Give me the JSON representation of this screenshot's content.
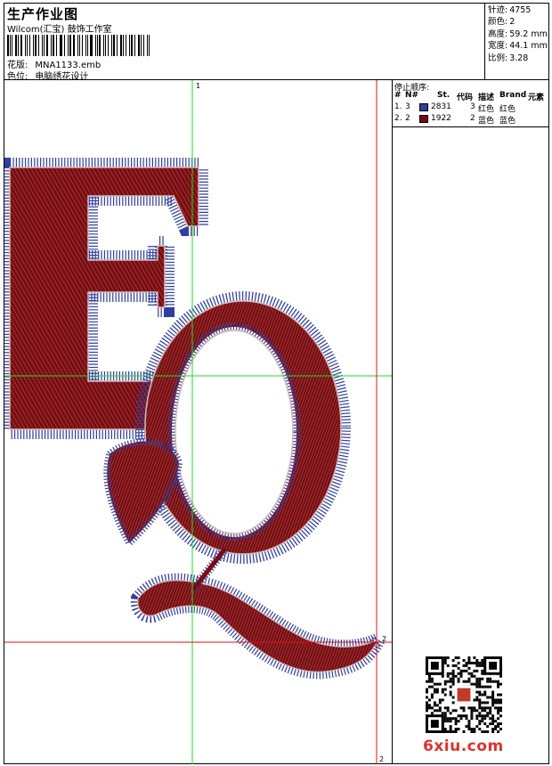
{
  "header": {
    "title": "生产作业图",
    "company": "Wilcom(汇宝) 鼓饰工作室",
    "design_label": "花版:",
    "design_value": "MNA1133.emb",
    "colorway_label": "色位:",
    "colorway_value": "电脑绣花设计"
  },
  "stats": {
    "stitches_label": "针迹:",
    "stitches_value": "4755",
    "colors_label": "颜色:",
    "colors_value": "2",
    "height_label": "高度:",
    "height_value": "59.2 mm",
    "width_label": "宽度:",
    "width_value": "44.1 mm",
    "scale_label": "比例:",
    "scale_value": "3.28"
  },
  "sequence": {
    "title": "停止顺序:",
    "headers": [
      "#",
      "N#",
      "St.",
      "代码",
      "描述",
      "Brand",
      "元素"
    ],
    "rows": [
      {
        "index": "1.",
        "needle": "3",
        "stitches": "2831",
        "code": "3",
        "desc": "红色",
        "brand": "红色",
        "color": "#2f3fa0"
      },
      {
        "index": "2.",
        "needle": "2",
        "stitches": "1922",
        "code": "2",
        "desc": "蓝色",
        "brand": "蓝色",
        "color": "#7a0c10"
      }
    ]
  },
  "canvas": {
    "marker_top": "1",
    "marker_right": "2",
    "marker_bottom": "2",
    "letters": "EQ",
    "fill_color": "#7a0c10",
    "outline_color": "#2f3fa0",
    "guide_green": "#22dd22",
    "guide_red": "#e01010"
  },
  "watermark": "6xiu.com"
}
